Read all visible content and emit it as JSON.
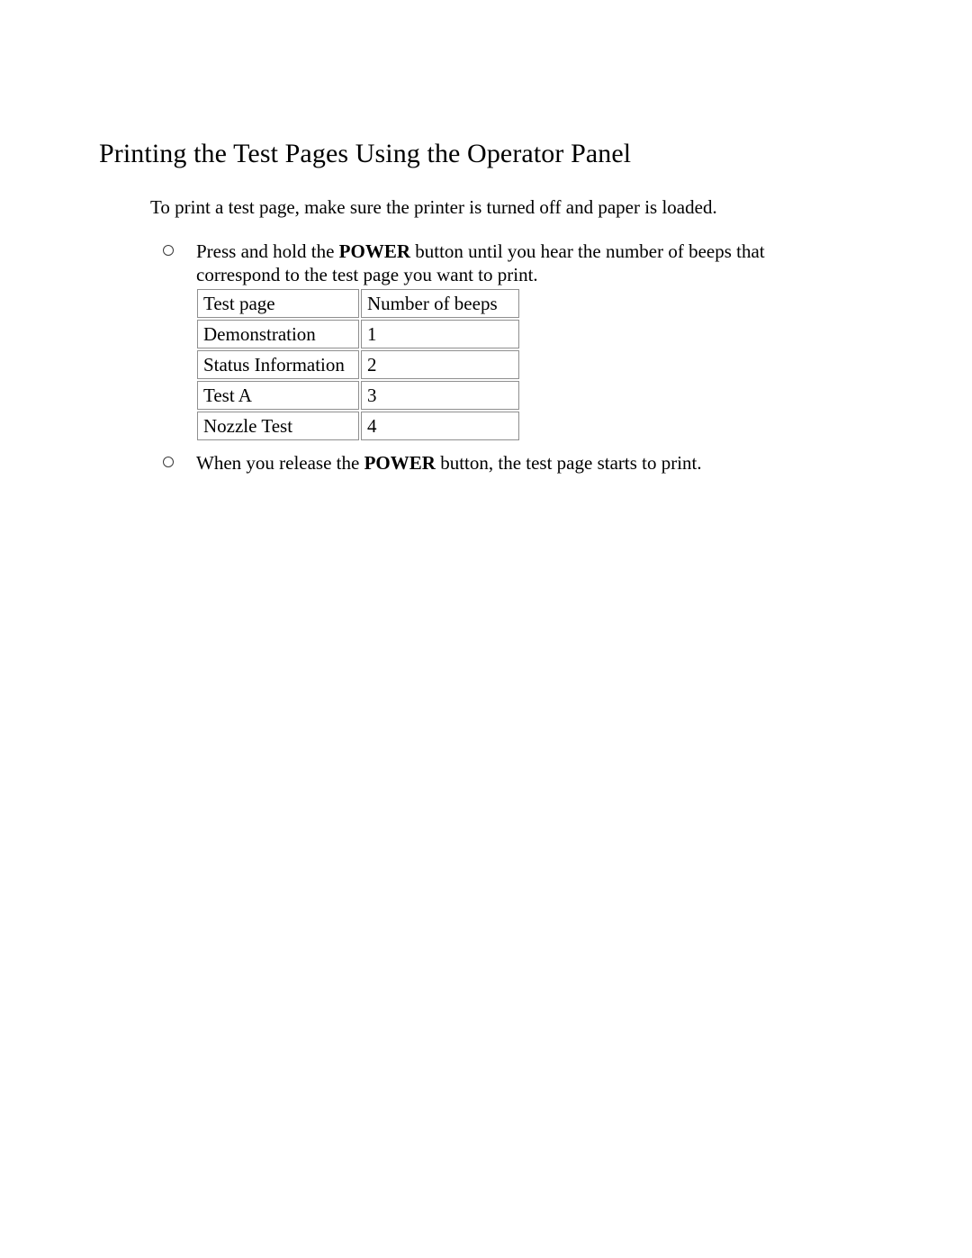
{
  "document": {
    "heading": "Printing the Test Pages Using the Operator Panel",
    "intro": "To print a test page, make sure the printer is turned off and paper is loaded.",
    "bullet_marker_icon": "open-circle-bullet-icon"
  },
  "steps": [
    {
      "line1_before": "Press and hold the ",
      "emphasis": "POWER",
      "line1_after": " button until you hear the number of beeps that",
      "line2": "correspond to the test page you want to print."
    },
    {
      "line1_before": "When you release the ",
      "emphasis": "POWER",
      "line1_after": " button, the test page starts to print.",
      "line2": ""
    }
  ],
  "table": {
    "headers": [
      "Test page",
      "Number of beeps"
    ],
    "rows": [
      [
        "Demonstration",
        "1"
      ],
      [
        "Status Information",
        "2"
      ],
      [
        "Test A",
        "3"
      ],
      [
        "Nozzle Test",
        "4"
      ]
    ]
  },
  "colors": {
    "page_background": "#ffffff",
    "text": "#000000",
    "table_border": "#8f8f8f"
  }
}
